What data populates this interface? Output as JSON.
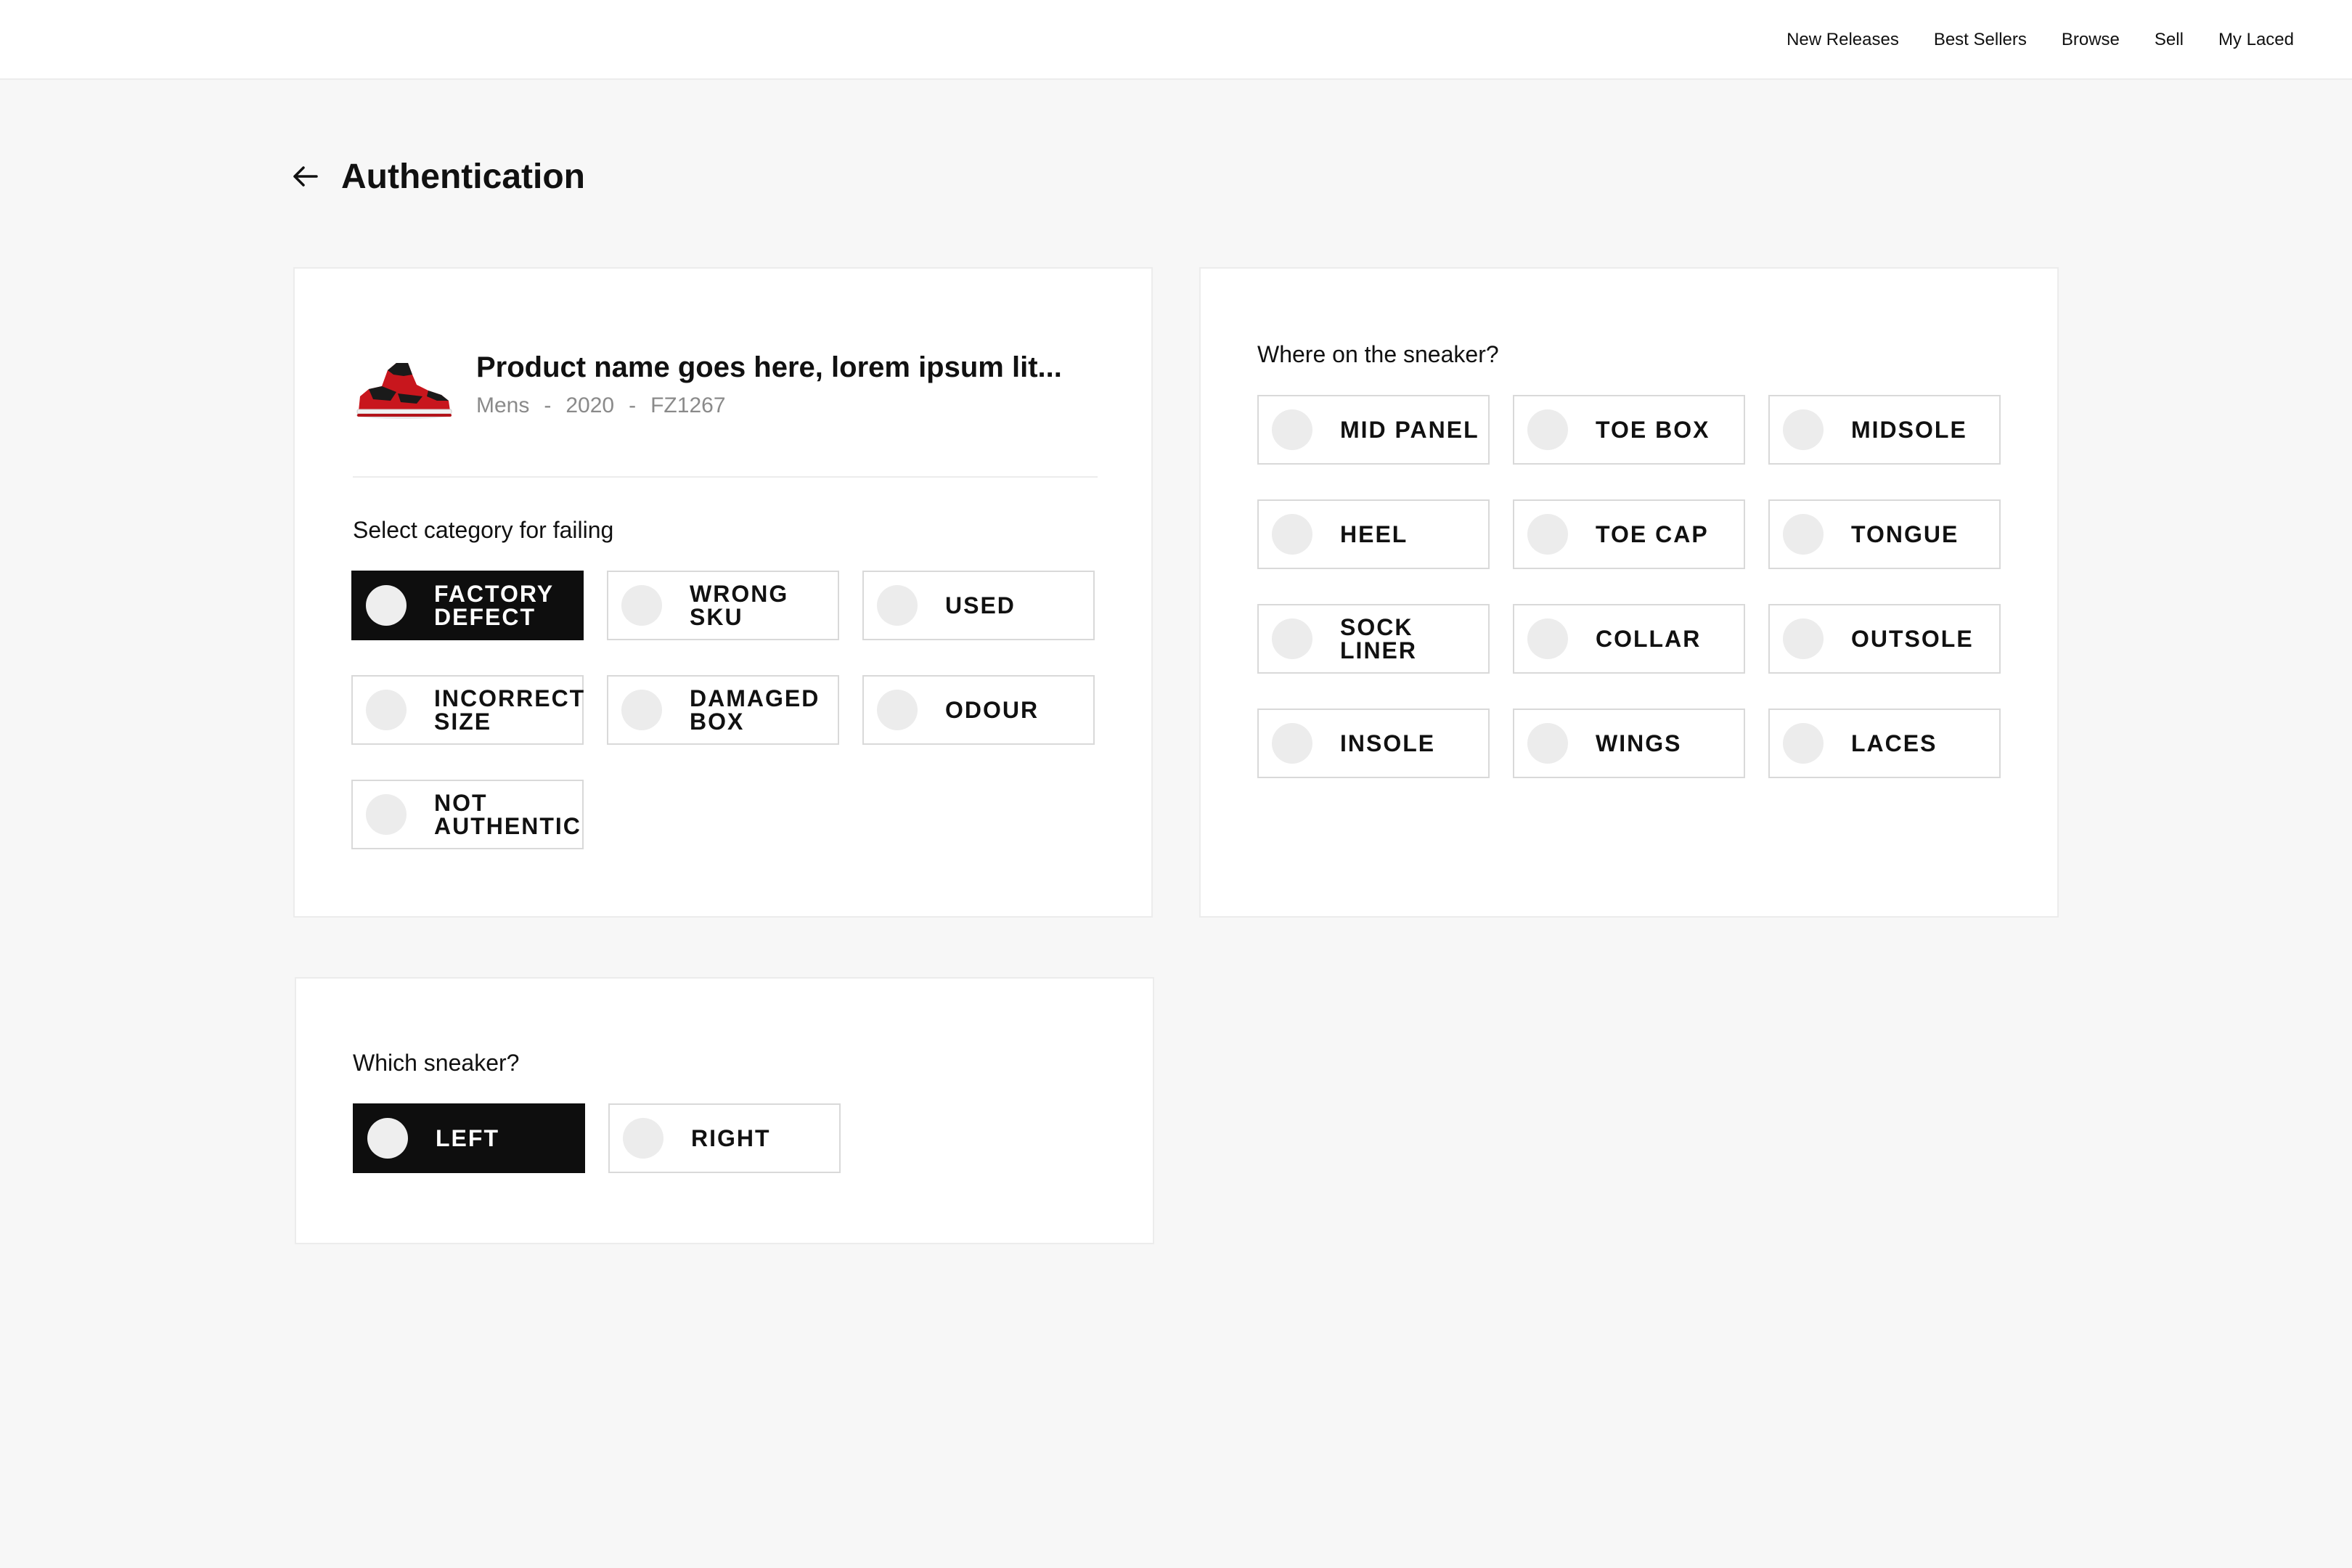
{
  "nav": {
    "items": [
      "New Releases",
      "Best Sellers",
      "Browse",
      "Sell",
      "My Laced"
    ]
  },
  "header": {
    "title": "Authentication"
  },
  "product": {
    "name": "Product name goes here, lorem ipsum lit...",
    "gender": "Mens",
    "year": "2020",
    "sku": "FZ1267",
    "separator": "-"
  },
  "failing": {
    "label": "Select category for failing",
    "options": [
      {
        "label": "Factory defect",
        "selected": true
      },
      {
        "label": "Wrong SKU",
        "selected": false
      },
      {
        "label": "Used",
        "selected": false
      },
      {
        "label": "Incorrect size",
        "selected": false
      },
      {
        "label": "Damaged box",
        "selected": false
      },
      {
        "label": "Odour",
        "selected": false
      },
      {
        "label": "Not authentic",
        "selected": false
      }
    ]
  },
  "location": {
    "label": "Where on the sneaker?",
    "options": [
      {
        "label": "Mid panel",
        "selected": false
      },
      {
        "label": "Toe box",
        "selected": false
      },
      {
        "label": "Midsole",
        "selected": false
      },
      {
        "label": "Heel",
        "selected": false
      },
      {
        "label": "Toe cap",
        "selected": false
      },
      {
        "label": "Tongue",
        "selected": false
      },
      {
        "label": "Sock liner",
        "selected": false
      },
      {
        "label": "Collar",
        "selected": false
      },
      {
        "label": "Outsole",
        "selected": false
      },
      {
        "label": "Insole",
        "selected": false
      },
      {
        "label": "Wings",
        "selected": false
      },
      {
        "label": "Laces",
        "selected": false
      }
    ]
  },
  "side": {
    "label": "Which sneaker?",
    "options": [
      {
        "label": "Left",
        "selected": true
      },
      {
        "label": "Right",
        "selected": false
      }
    ]
  },
  "colors": {
    "selected_bg": "#0e0e0e",
    "radio": "#ececec",
    "page_bg": "#f7f7f7",
    "meta_text": "#8a8a8a"
  }
}
